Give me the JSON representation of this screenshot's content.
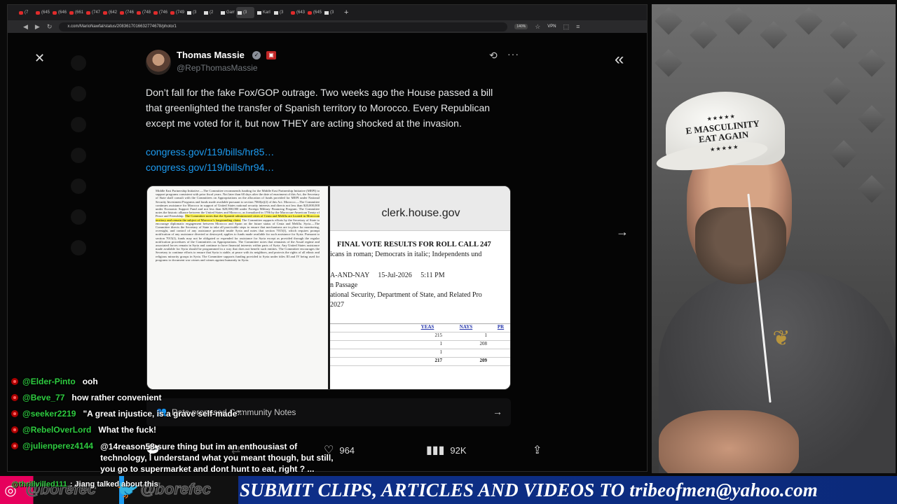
{
  "browser": {
    "tabs": [
      {
        "label": "(7",
        "type": "yt"
      },
      {
        "label": "(645",
        "type": "yt"
      },
      {
        "label": "(646",
        "type": "yt"
      },
      {
        "label": "(661",
        "type": "yt"
      },
      {
        "label": "(747",
        "type": "yt"
      },
      {
        "label": "(642",
        "type": "yt"
      },
      {
        "label": "(746",
        "type": "yt"
      },
      {
        "label": "(748",
        "type": "yt"
      },
      {
        "label": "(746",
        "type": "yt"
      },
      {
        "label": "(749",
        "type": "yt"
      },
      {
        "label": "(3",
        "type": "x"
      },
      {
        "label": "(2",
        "type": "x"
      },
      {
        "label": "Gam",
        "type": "x"
      },
      {
        "label": "(3",
        "type": "x",
        "active": true
      },
      {
        "label": "Karl",
        "type": "x"
      },
      {
        "label": "(3",
        "type": "x"
      },
      {
        "label": "(643",
        "type": "yt"
      },
      {
        "label": "(645",
        "type": "yt"
      },
      {
        "label": "(3",
        "type": "x"
      }
    ],
    "new_tab": "+",
    "url": "x.com/MarioNawfal/status/2083617016632774678/photo/1",
    "zoom": "140%",
    "vpn": "VPN"
  },
  "tweet": {
    "author_name": "Thomas Massie",
    "author_handle": "@RepThomasMassie",
    "text": "Don’t fall for the fake Fox/GOP outrage. Two weeks ago the House passed a bill that greenlighted the transfer of Spanish territory to Morocco. Every Republican except me voted for it, but now THEY are acting shocked at the invasion.",
    "links": [
      "congress.gov/119/bills/hr85…",
      "congress.gov/119/bills/hr94…"
    ],
    "media": {
      "doc_left_text_before": "Middle East Partnership Initiative.—The Committee recommends funding for the Middle East Partnership Initiative (MEPI) to support programs consistent with prior fiscal years. Not later than 60 days after the date of enactment of this Act, the Secretary of State shall consult with the Committees on Appropriations on the allocation of funds provided for MEPI under National Security Investment Programs and funds made available pursuant to section 7060(a)(2) of this Act. Morocco.—The Committee continues assistance for Morocco in support of United States national security interests and directs not less than $20,000,000 under Economic Support Fund and not less than $20,000,000 under Foreign Military Financing Program. The Committee notes the historic alliance between the United States and Morocco, as formalized in 1786 by the Moroccan-American Treaty of Peace and Friendship.",
      "doc_left_highlight": "The Committee notes that the Spanish-administered cities of Ceuta and Melilla are located in Moroccan territory and remain the subject of Morocco’s longstanding claim.",
      "doc_left_text_after": "The Committee supports efforts by the Secretary of State to encourage diplomatic engagement between Morocco and Spain on the future status of Ceuta and Melilla. Syria.—The Committee directs the Secretary of State to take all practicable steps to ensure that mechanisms are in place for monitoring, oversight, and control of any assistance provided inside Syria and notes that section 7015(f), which requires prompt notification of any assistance diverted or destroyed, applies to funds made available for such assistance for Syria. Pursuant to section 7015(f), funds may not be obligated or expended for assistance for Syria except as provided through the regular notification procedures of the Committees on Appropriations. The Committee notes that remnants of the Assad regime and associated forces remain in Syria and continue to have financial interests within parts of Syria. Any United States assistance made available for Syria should be programmed in a way that does not benefit such entities. The Committee encourages the Secretary to continue efforts to ensure that Syria is stable, at peace with its neighbors, and protects the rights of all ethnic and religious minority groups in Syria. The Committee supports funding provided to Syria under titles III and IV being used for programs to document war crimes and crimes against humanity in Syria.",
      "clerk_url": "clerk.house.gov",
      "roll_title": "FINAL VOTE RESULTS FOR ROLL CALL 247",
      "roll_sub": "icans in roman; Democrats in italic; Independents und",
      "roll_vote": "A-AND-NAY     15-Jul-2026     5:11 PM",
      "roll_question": "n Passage",
      "roll_bill": "ational Security, Department of State, and Related Pro",
      "roll_year": "2027",
      "table_head": [
        "YEAS",
        "NAYS",
        "PR"
      ],
      "table_rows": [
        [
          "215",
          "1",
          ""
        ],
        [
          "1",
          "208",
          ""
        ],
        [
          "1",
          "",
          ""
        ],
        [
          "217",
          "209",
          ""
        ]
      ]
    },
    "community_notes": "Rate proposed Community Notes",
    "actions": {
      "replies": "",
      "reposts": "",
      "likes": "964",
      "views": "92K"
    }
  },
  "chat": [
    {
      "user": "@Elder-Pinto",
      "text": "ooh"
    },
    {
      "user": "@Beve_77",
      "text": "how rather convenient"
    },
    {
      "user": "@seeker2219",
      "text": "\"A great injustice, is a grave self-made\""
    },
    {
      "user": "@RebelOverLord",
      "text": "What the fuck!"
    },
    {
      "user": "@julienperez4144",
      "text": "@14reason58 sure thing but im an enthousiast of technology, I understand what you meant though, but still, you go to supermarket and dont hunt to eat, right ? ..."
    }
  ],
  "webcam": {
    "cap_stars_top": "★★★★★",
    "cap_line1": "E MASCULINITY",
    "cap_line2": "EAT AGAIN",
    "cap_stars_bottom": "★★★★★"
  },
  "banner": {
    "handle1": "@borefec",
    "handle2": "@borefec",
    "chat_user": "@thrillvilled111",
    "chat_text": ": Jiang talked about this",
    "text": "SUBMIT CLIPS, ARTICLES AND VIDEOS TO tribeofmen@yahoo.com"
  },
  "colors": {
    "link": "#1d9bf0",
    "chat_user": "#2ecc40",
    "banner_bg": "#0e2f89",
    "highlight": "#fff34a"
  }
}
